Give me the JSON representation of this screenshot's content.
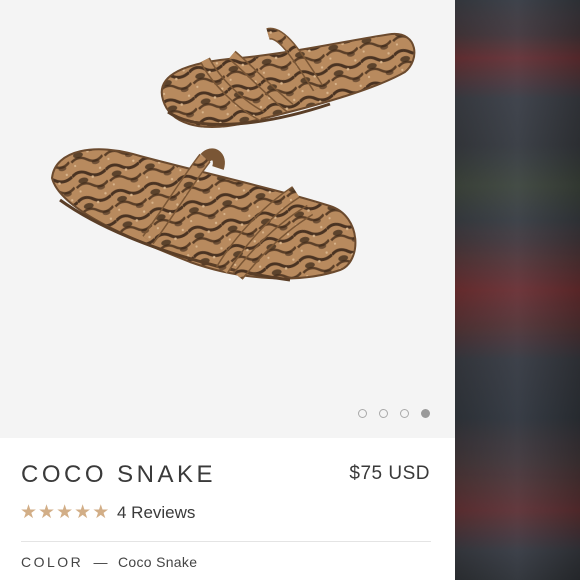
{
  "product": {
    "title": "COCO SNAKE",
    "price": "$75 USD",
    "rating": 5,
    "reviews_label": "4 Reviews",
    "color_label": "COLOR",
    "color_separator": "—",
    "color_value": "Coco Snake"
  },
  "carousel": {
    "count": 4,
    "active_index": 3
  },
  "colors": {
    "star": "#d2ae87",
    "text": "#3a3a3a",
    "image_bg": "#f4f4f4"
  }
}
